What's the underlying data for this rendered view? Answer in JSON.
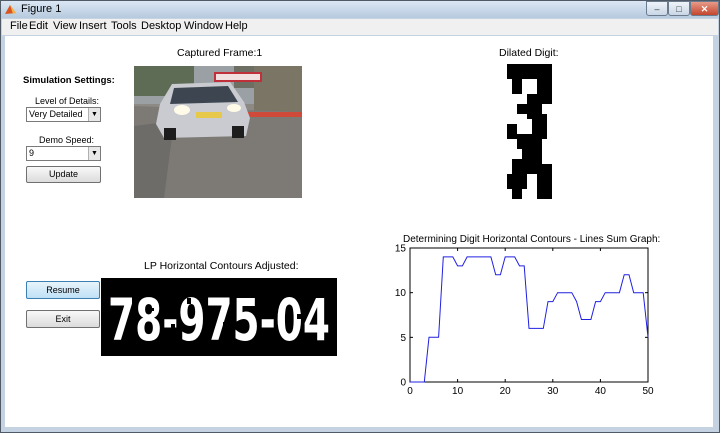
{
  "window": {
    "title": "Figure 1",
    "controls": {
      "minimize": "–",
      "maximize": "□",
      "close": "✕"
    }
  },
  "menubar": {
    "items": [
      "File",
      "Edit",
      "View",
      "Insert",
      "Tools",
      "Desktop",
      "Window",
      "Help"
    ]
  },
  "settings": {
    "heading": "Simulation Settings:",
    "level_label": "Level of Details:",
    "level_value": "Very Detailed",
    "speed_label": "Demo Speed:",
    "speed_value": "9",
    "update_label": "Update"
  },
  "controls": {
    "resume_label": "Resume",
    "exit_label": "Exit"
  },
  "panels": {
    "captured_title": "Captured Frame:1",
    "dilated_title": "Dilated Digit:",
    "lp_title": "LP Horizontal Contours Adjusted:",
    "plate_text": "78-975-04"
  },
  "chart_data": {
    "type": "line",
    "title": "Determining Digit Horizontal Contours - Lines Sum Graph:",
    "xlim": [
      0,
      50
    ],
    "ylim": [
      0,
      15
    ],
    "xticks": [
      0,
      10,
      20,
      30,
      40,
      50
    ],
    "yticks": [
      0,
      5,
      10,
      15
    ],
    "x": [
      0,
      1,
      2,
      3,
      4,
      5,
      6,
      7,
      8,
      9,
      10,
      11,
      12,
      13,
      14,
      15,
      16,
      17,
      18,
      19,
      20,
      21,
      22,
      23,
      24,
      25,
      26,
      27,
      28,
      29,
      30,
      31,
      32,
      33,
      34,
      35,
      36,
      37,
      38,
      39,
      40,
      41,
      42,
      43,
      44,
      45,
      46,
      47,
      48,
      49,
      50
    ],
    "y": [
      0,
      0,
      0,
      0,
      5,
      5,
      5,
      14,
      14,
      14,
      13,
      13,
      14,
      14,
      14,
      14,
      14,
      14,
      12,
      12,
      14,
      14,
      14,
      13,
      13,
      6,
      6,
      6,
      6,
      9,
      9,
      10,
      10,
      10,
      10,
      9,
      7,
      7,
      7,
      9,
      9,
      10,
      10,
      10,
      10,
      12,
      12,
      10,
      10,
      10,
      5
    ],
    "line_color": "#2020e0",
    "grid": false
  }
}
